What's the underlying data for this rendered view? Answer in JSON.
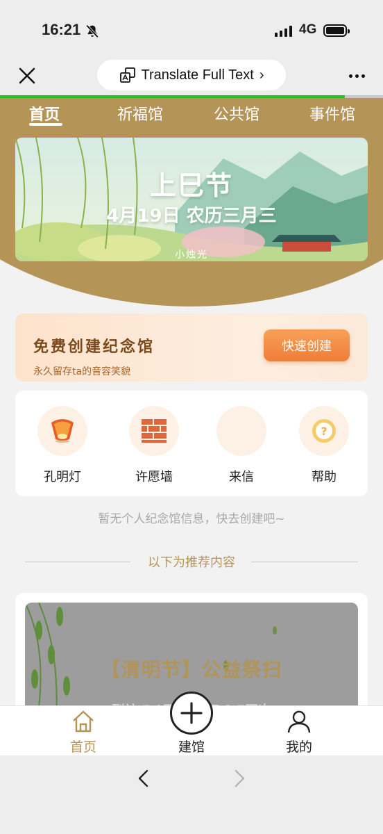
{
  "status_bar": {
    "time": "16:21",
    "network": "4G"
  },
  "browser": {
    "translate_label": "Translate Full Text",
    "translate_chevron": "›",
    "load_progress": 0.9
  },
  "tabs": [
    {
      "label": "首页",
      "active": true
    },
    {
      "label": "祈福馆",
      "active": false
    },
    {
      "label": "公共馆",
      "active": false
    },
    {
      "label": "事件馆",
      "active": false
    }
  ],
  "banner": {
    "title": "上巳节",
    "subtitle": "4月19日 农历三月三",
    "brand": "小烛光"
  },
  "create_card": {
    "title": "免费创建纪念馆",
    "subtitle": "永久留存ta的音容笑貌",
    "button": "快速创建"
  },
  "menu": [
    {
      "label": "孔明灯",
      "icon": "sky-lantern-icon"
    },
    {
      "label": "许愿墙",
      "icon": "brick-wall-icon"
    },
    {
      "label": "来信",
      "icon": "letter-icon"
    },
    {
      "label": "帮助",
      "icon": "help-icon"
    }
  ],
  "empty_tip": "暂无个人纪念馆信息，快去创建吧~",
  "recommend_header": "以下为推荐内容",
  "recommend_card": {
    "title": "【清明节】公益祭扫",
    "subtitle": "到访 7.9万次 祭扫 2.7万次"
  },
  "bottom_nav": [
    {
      "label": "首页",
      "icon": "home-icon",
      "active": true
    },
    {
      "label": "建馆",
      "icon": "plus-circle-icon",
      "active": false
    },
    {
      "label": "我的",
      "icon": "user-icon",
      "active": false
    }
  ],
  "colors": {
    "brand_gold": "#b59457",
    "accent_orange": "#ef7d37",
    "progress_green": "#2bbf2b"
  }
}
